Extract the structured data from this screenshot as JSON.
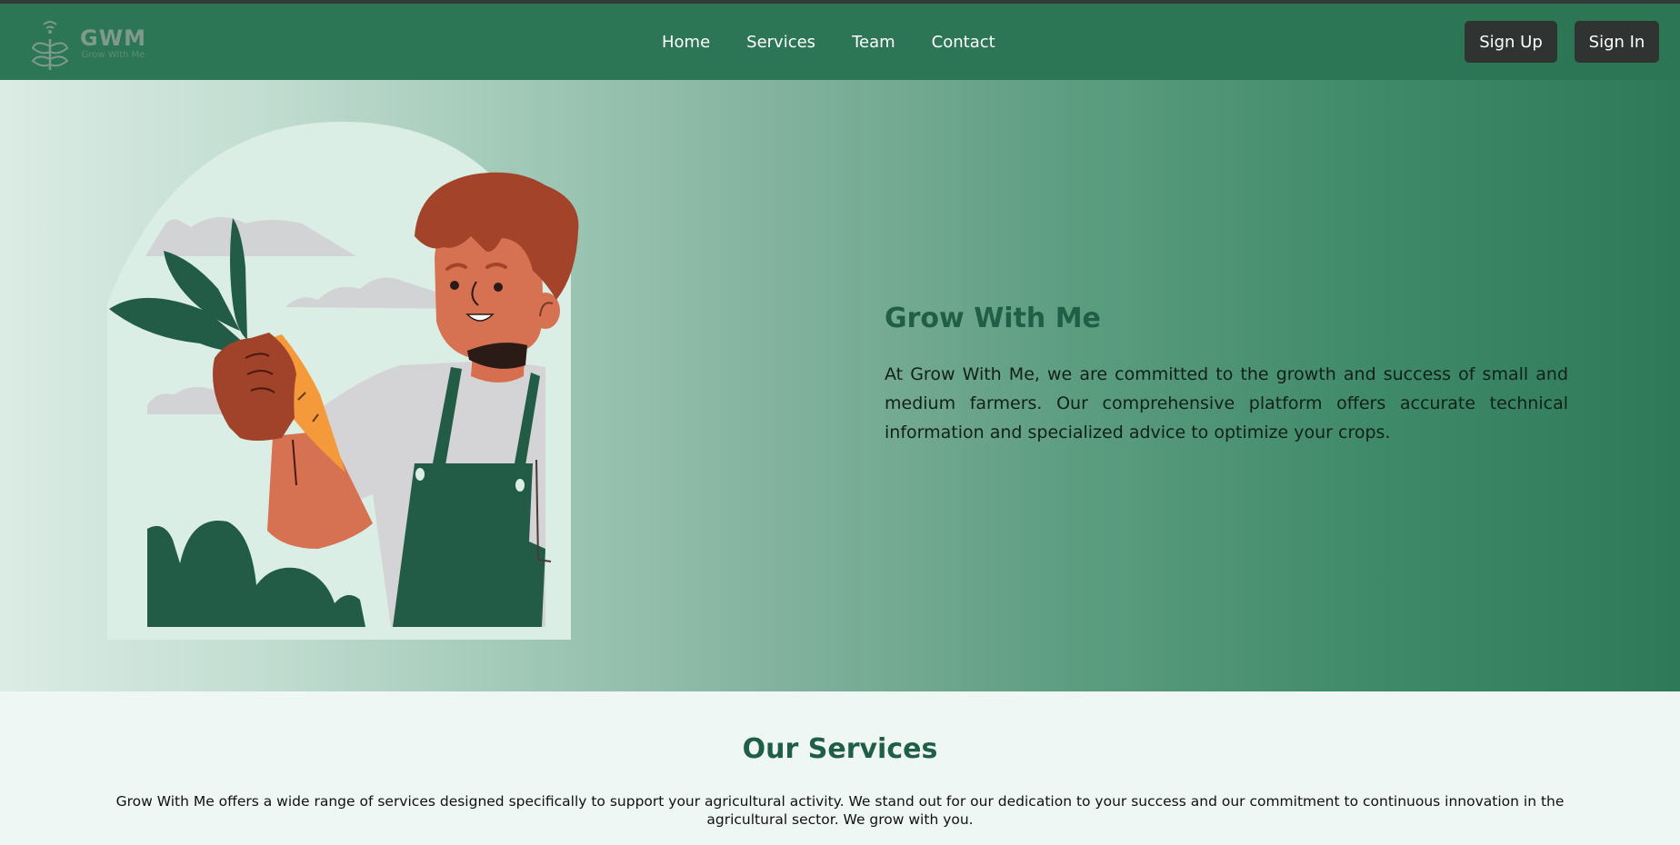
{
  "header": {
    "logo": {
      "title": "GWM",
      "subtitle": "Grow With Me",
      "icon": "sprout-wifi-icon"
    },
    "nav": [
      {
        "label": "Home"
      },
      {
        "label": "Services"
      },
      {
        "label": "Team"
      },
      {
        "label": "Contact"
      }
    ],
    "sign_up_label": "Sign Up",
    "sign_in_label": "Sign In"
  },
  "hero": {
    "title": "Grow With Me",
    "description": "At Grow With Me, we are committed to the growth and success of small and medium farmers. Our comprehensive platform offers accurate technical information and specialized advice to optimize your crops.",
    "illustration": "farmer-holding-carrot-illustration"
  },
  "services": {
    "title": "Our Services",
    "description": "Grow With Me offers a wide range of services designed specifically to support your agricultural activity. We stand out for our dedication to your success and our commitment to continuous innovation in the agricultural sector. We grow with you."
  },
  "colors": {
    "header_bg": "#2c7656",
    "accent_dark": "#215e47",
    "button_bg": "#2f3331"
  }
}
